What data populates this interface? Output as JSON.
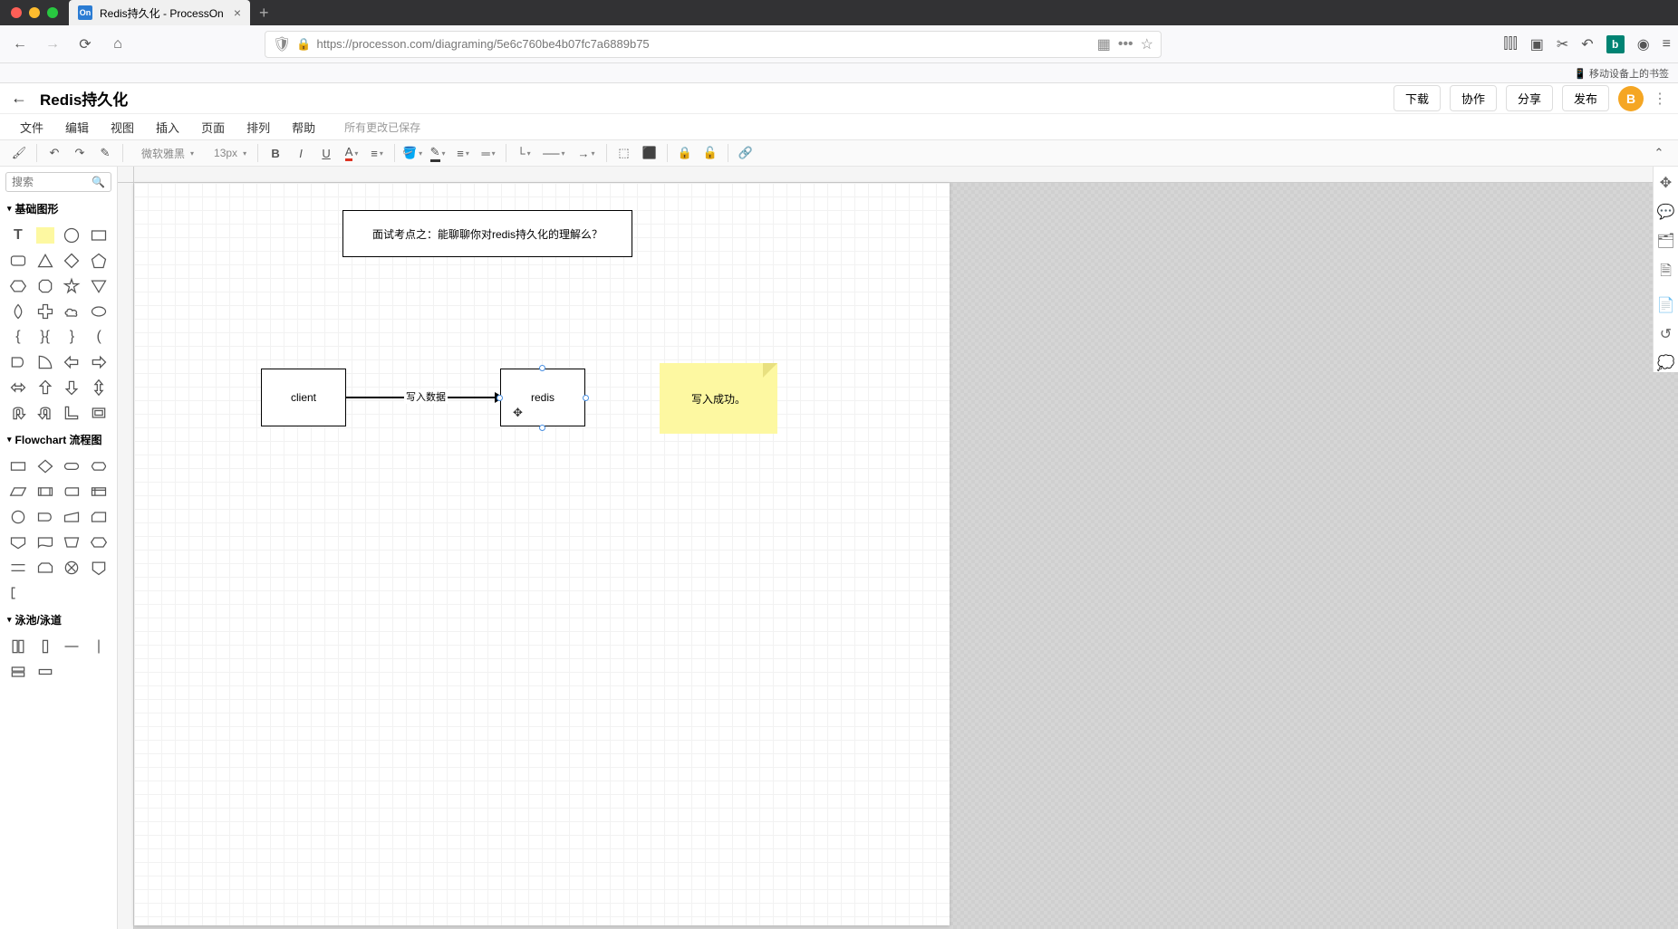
{
  "browser": {
    "tab_title": "Redis持久化 - ProcessOn",
    "url": "https://processon.com/diagraming/5e6c760be4b07fc7a6889b75",
    "bookmark_hint": "移动设备上的书签"
  },
  "header": {
    "doc_title": "Redis持久化",
    "buttons": {
      "download": "下载",
      "collab": "协作",
      "share": "分享",
      "publish": "发布"
    },
    "avatar": "B"
  },
  "menu": {
    "file": "文件",
    "edit": "编辑",
    "view": "视图",
    "insert": "插入",
    "page": "页面",
    "arrange": "排列",
    "help": "帮助",
    "save_status": "所有更改已保存"
  },
  "toolbar": {
    "font_family": "微软雅黑",
    "font_size": "13px"
  },
  "left_panel": {
    "search_placeholder": "搜索",
    "sections": {
      "basic": "基础图形",
      "flowchart": "Flowchart 流程图",
      "swimlane": "泳池/泳道"
    }
  },
  "diagram": {
    "title_box": "面试考点之：能聊聊你对redis持久化的理解么？",
    "client_box": "client",
    "redis_box": "redis",
    "arrow_label": "写入数据",
    "sticky_note": "写入成功。"
  }
}
